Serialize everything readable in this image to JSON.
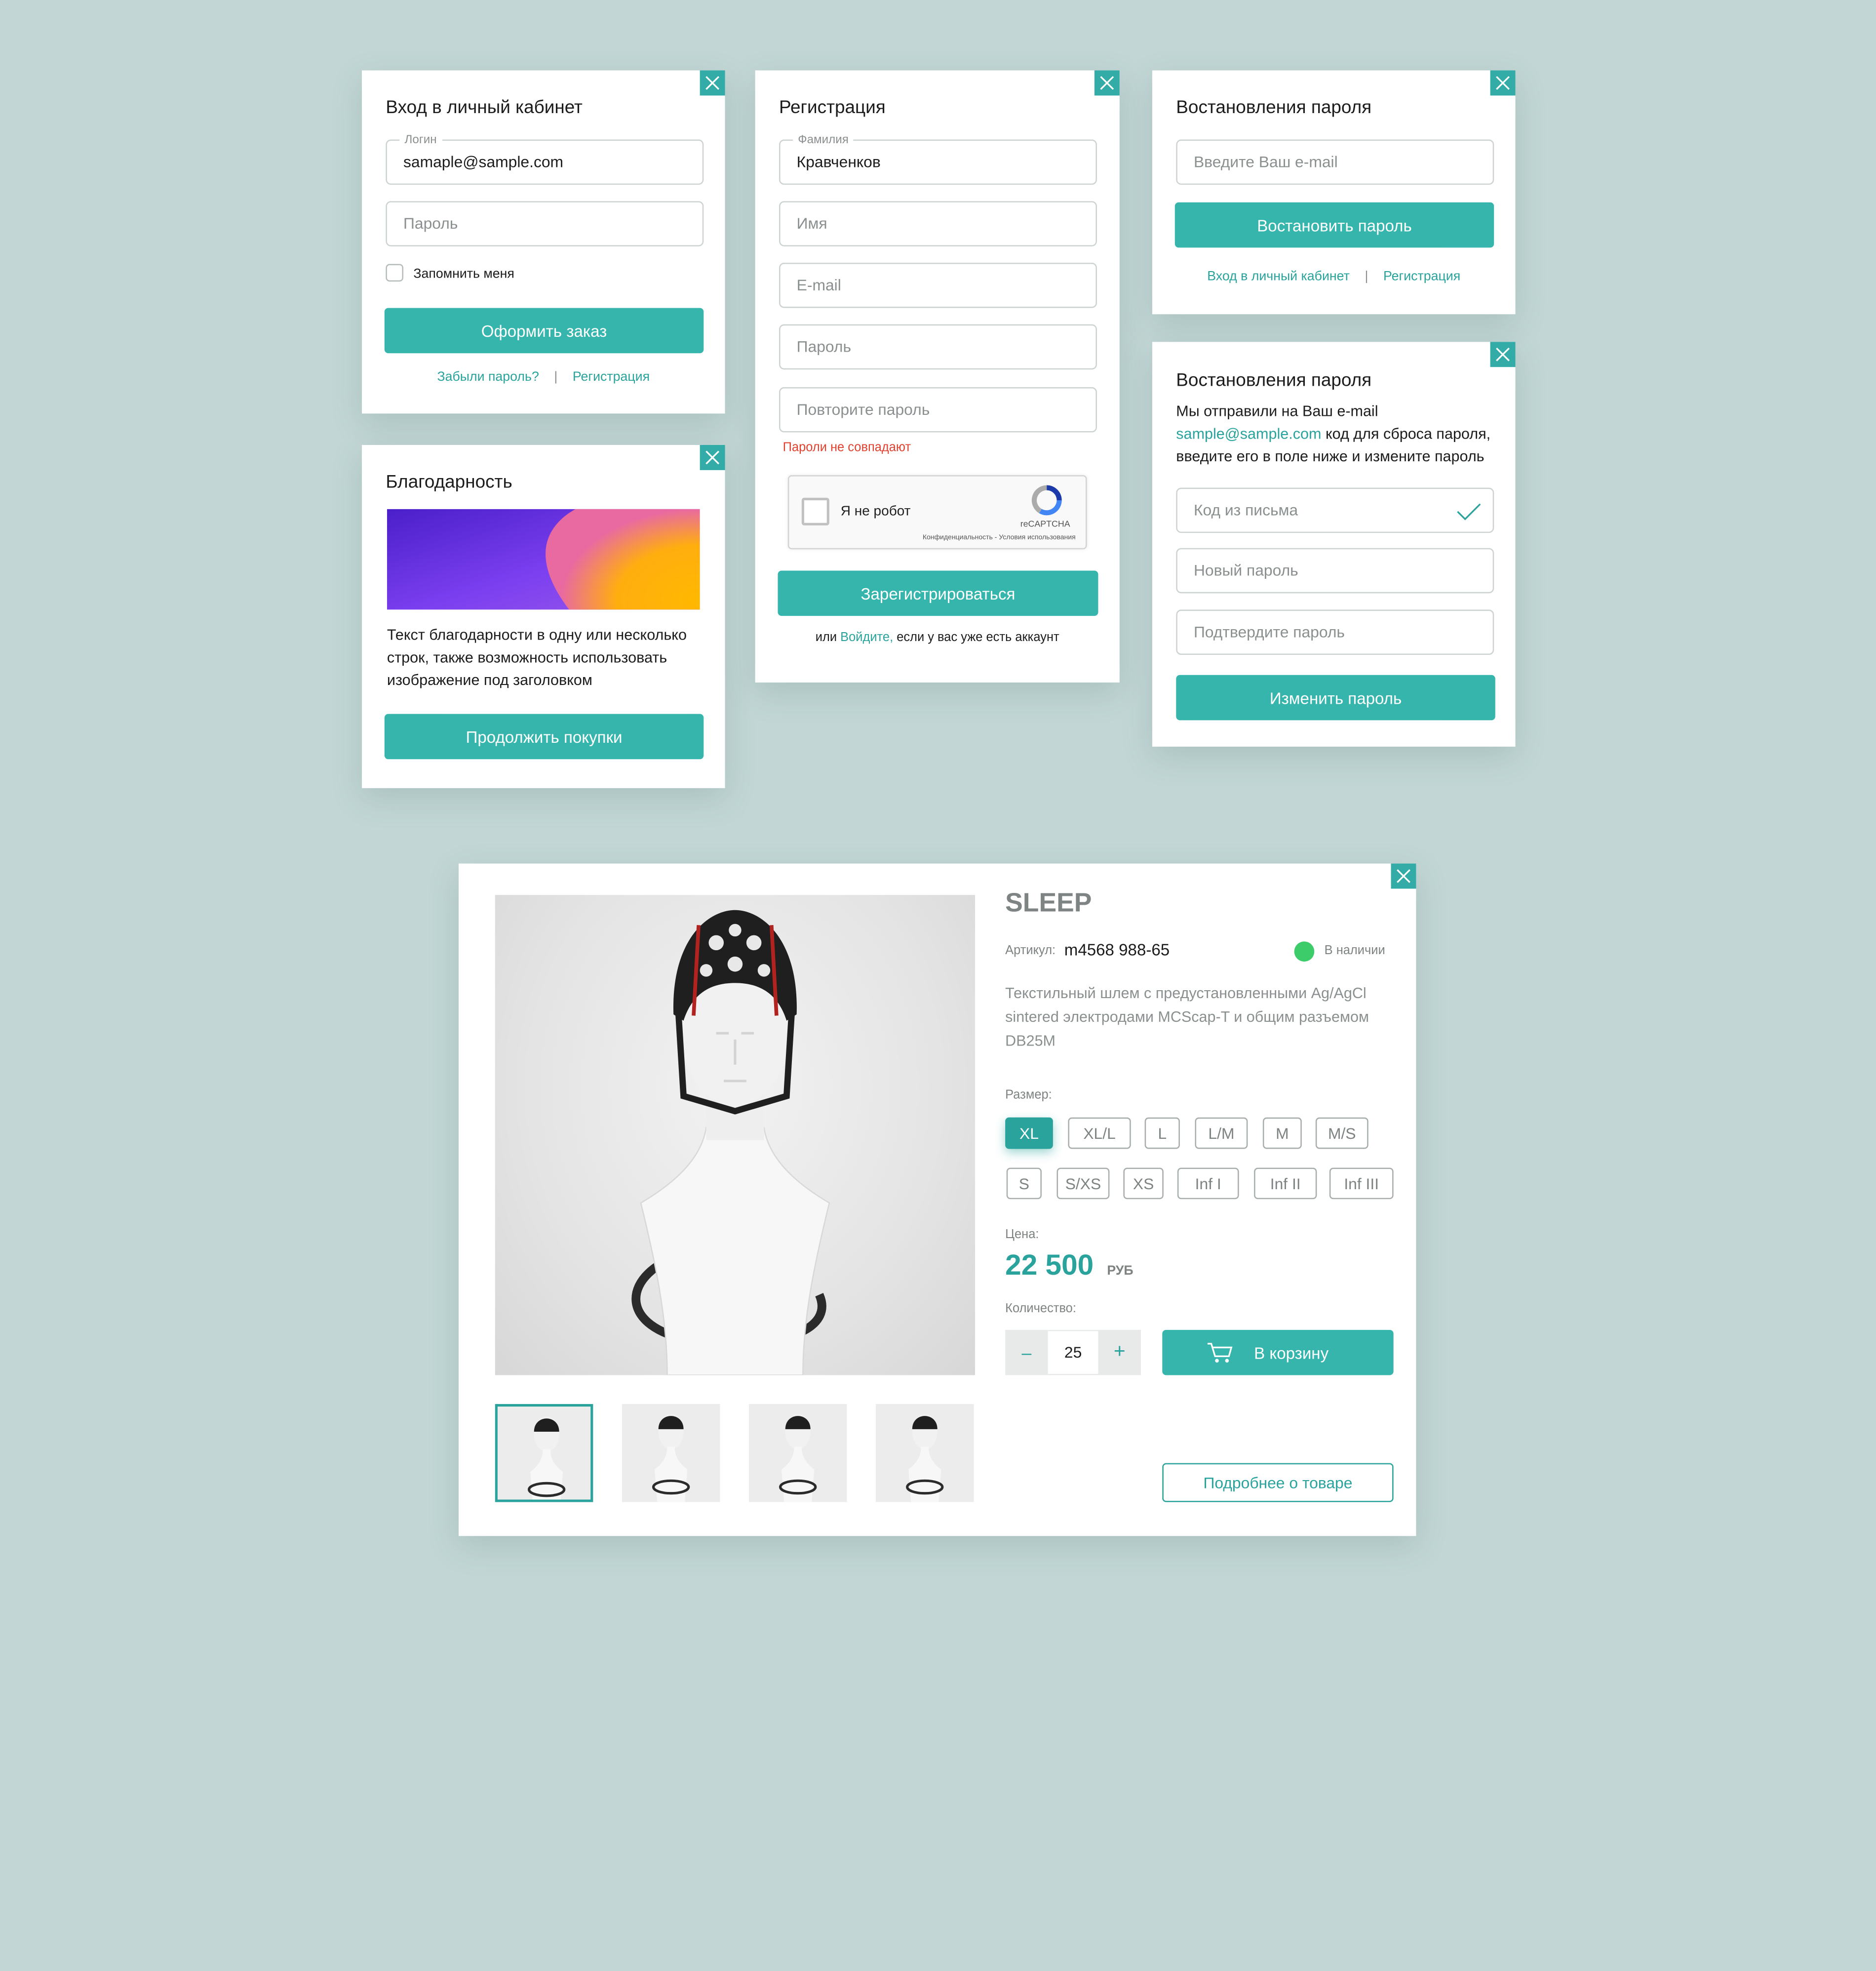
{
  "colors": {
    "background": "#c2d7d5",
    "accent": "#36b5ad",
    "link": "#2aa39c",
    "error": "#e0412f",
    "in_stock": "#3ccc6a"
  },
  "login": {
    "title": "Вход в личный кабинет",
    "login_label": "Логин",
    "login_value": "samaple@sample.com",
    "password_placeholder": "Пароль",
    "remember_label": "Запомнить меня",
    "submit_label": "Оформить заказ",
    "forgot_link": "Забыли пароль?",
    "separator": "|",
    "register_link": "Регистрация"
  },
  "thanks": {
    "title": "Благодарность",
    "text": "Текст благодарности в одну или несколько строк, также возможность использовать изображение под заголовком",
    "button_label": "Продолжить покупки"
  },
  "registration": {
    "title": "Регистрация",
    "surname_label": "Фамилия",
    "surname_value": "Кравченков",
    "name_placeholder": "Имя",
    "email_placeholder": "E-mail",
    "password_placeholder": "Пароль",
    "repeat_placeholder": "Повторите пароль",
    "error_text": "Пароли не совпадают",
    "captcha_label": "Я не робот",
    "captcha_brand": "reCAPTCHA",
    "captcha_footer": "Конфиденциальность - Условия использования",
    "submit_label": "Зарегистрироваться",
    "footer_prefix": "или",
    "footer_link": "Войдите,",
    "footer_suffix": "если у вас уже есть аккаунт"
  },
  "restore": {
    "title": "Востановления пароля",
    "email_placeholder": "Введите Ваш e-mail",
    "button_label": "Востановить пароль",
    "login_link": "Вход в личный кабинет",
    "separator": "|",
    "register_link": "Регистрация"
  },
  "restore_code": {
    "title": "Востановления пароля",
    "text_prefix": "Мы отправили на Ваш e-mail",
    "email": "sample@sample.com",
    "text_suffix": "код для сброса пароля, введите его в поле ниже и измените пароль",
    "code_placeholder": "Код из письма",
    "new_password_placeholder": "Новый пароль",
    "confirm_placeholder": "Подтвердите пароль",
    "button_label": "Изменить пароль"
  },
  "product": {
    "name": "SLEEP",
    "article_label": "Артикул:",
    "article_value": "m4568 988-65",
    "stock_status": "В наличии",
    "description": "Текстильный шлем с предустановленными Ag/AgCl sintered электродами MCScap-T и общим разъемом DB25M",
    "size_label": "Размер:",
    "sizes": [
      "XL",
      "XL/L",
      "L",
      "L/M",
      "M",
      "M/S",
      "S",
      "S/XS",
      "XS",
      "Inf I",
      "Inf II",
      "Inf III"
    ],
    "selected_size": "XL",
    "price_label": "Цена:",
    "price_value": "22 500",
    "price_currency": "РУБ",
    "quantity_label": "Количество:",
    "quantity_value": "25",
    "minus": "–",
    "plus": "+",
    "cart_button": "В корзину",
    "details_button": "Подробнее о товаре",
    "thumbnail_count": 4,
    "selected_thumbnail": 1
  }
}
